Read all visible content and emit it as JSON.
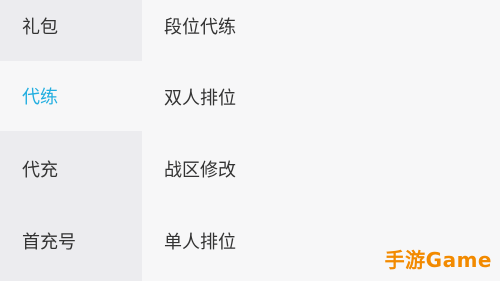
{
  "sidebar": {
    "items": [
      {
        "label": "礼包"
      },
      {
        "label": "代练"
      },
      {
        "label": "代充"
      },
      {
        "label": "首充号"
      }
    ],
    "active_index": 1
  },
  "main": {
    "items": [
      {
        "label": "段位代练"
      },
      {
        "label": "双人排位"
      },
      {
        "label": "战区修改"
      },
      {
        "label": "单人排位"
      }
    ]
  },
  "watermark": {
    "text": "手游Game"
  },
  "colors": {
    "accent": "#22aee0",
    "watermark": "#f28a00"
  }
}
